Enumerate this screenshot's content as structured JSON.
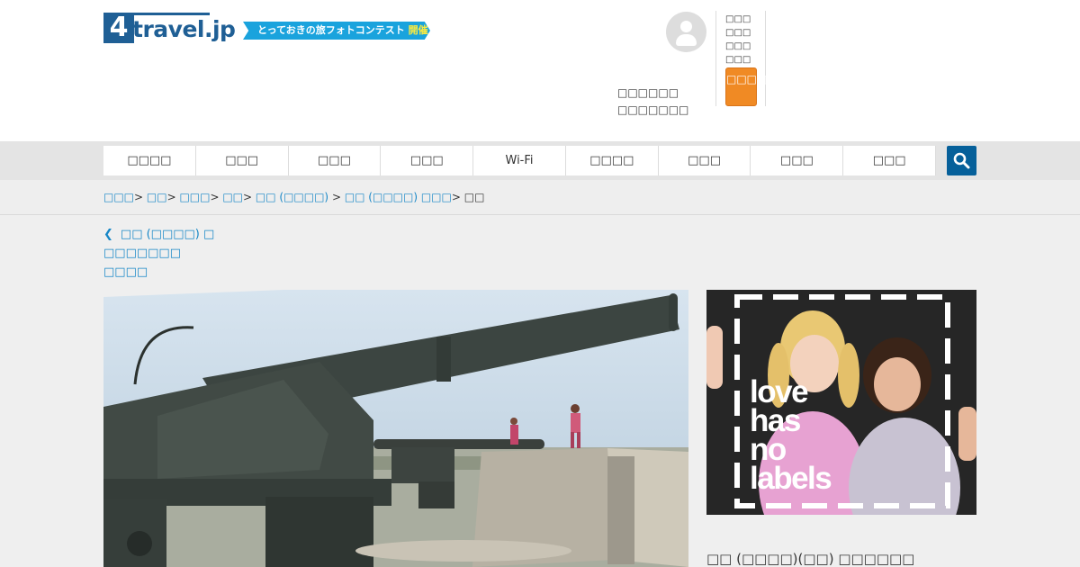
{
  "header": {
    "logo_number": "4",
    "logo_text": "travel.jp",
    "banner_text": "とっておきの旅フォトコンテスト",
    "banner_accent": "開催中",
    "user_info_lines": [
      "□□□□□□",
      "□□□□□□□"
    ],
    "login_message": "□□□□□□□□□□□□□□",
    "login_button": "□□□□□□"
  },
  "nav": {
    "items": [
      {
        "label": "□□□□",
        "active": true
      },
      {
        "label": "□□□",
        "active": false
      },
      {
        "label": "□□□",
        "active": false
      },
      {
        "label": "□□□",
        "active": false
      },
      {
        "label": "Wi-Fi",
        "active": false
      },
      {
        "label": "□□□□",
        "active": true
      },
      {
        "label": "□□□",
        "active": false
      },
      {
        "label": "□□□",
        "active": false
      },
      {
        "label": "□□□",
        "active": false
      }
    ],
    "search_icon": "search-icon"
  },
  "breadcrumb": {
    "items": [
      "□□□",
      "□□",
      "□□□",
      "□□",
      "□□ (□□□□)",
      "□□ (□□□□) □□□"
    ],
    "current": "□□"
  },
  "back_link": {
    "line1": "□□ (□□□□) □",
    "line2": "□□□□□□□ □□□□"
  },
  "ad": {
    "words": [
      "love",
      "has",
      "no",
      "labels"
    ]
  },
  "sidebar": {
    "title": "□□ (□□□□)(□□) □□□□□□"
  },
  "colors": {
    "brand": "#06609a",
    "link": "#1787c7",
    "login_button": "#f08a24",
    "banner": "#1aa3dd"
  }
}
